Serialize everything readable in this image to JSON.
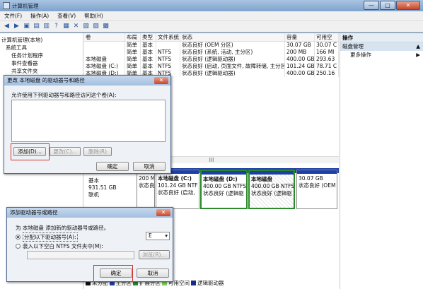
{
  "window": {
    "title": "计算机管理",
    "btn_min": "—",
    "btn_max": "□",
    "btn_close": "✕"
  },
  "menu": [
    "文件(F)",
    "操作(A)",
    "查看(V)",
    "帮助(H)"
  ],
  "tree": [
    "计算机管理(本地)",
    "系统工具",
    "任务计划程序",
    "事件查看器",
    "共享文件夹"
  ],
  "volumes": {
    "headers": [
      "卷",
      "布局",
      "类型",
      "文件系统",
      "状态",
      "容量",
      "可用空"
    ],
    "rows": [
      [
        "",
        "简单",
        "基本",
        "",
        "状态良好 (OEM 分区)",
        "30.07 GB",
        "30.07 C"
      ],
      [
        "",
        "简单",
        "基本",
        "NTFS",
        "状态良好 (系统, 活动, 主分区)",
        "200 MB",
        "166 MI"
      ],
      [
        "本地磁盘",
        "简单",
        "基本",
        "NTFS",
        "状态良好 (逻辑驱动器)",
        "400.00 GB",
        "293.63"
      ],
      [
        "本地磁盘 (C:)",
        "简单",
        "基本",
        "NTFS",
        "状态良好 (启动, 页面文件, 故障转储, 主分区)",
        "101.24 GB",
        "78.71 C"
      ],
      [
        "本地磁盘 (D:)",
        "简单",
        "基本",
        "NTFS",
        "状态良好 (逻辑驱动器)",
        "400.00 GB",
        "250.16"
      ]
    ]
  },
  "actions": {
    "header": "操作",
    "sub": "磁盘管理",
    "more": "更多操作"
  },
  "disk": {
    "type": "基本",
    "size": "931.51 GB",
    "status": "联机",
    "parts": [
      {
        "line1": "",
        "line2": "200 M",
        "line3": "状态良"
      },
      {
        "line1": "本地磁盘 (C:)",
        "line2": "101.24 GB NTF",
        "line3": "状态良好 (启动,"
      },
      {
        "line1": "本地磁盘 (D:)",
        "line2": "400.00 GB NTFS",
        "line3": "状态良好 (逻辑驱"
      },
      {
        "line1": "本地磁盘",
        "line2": "400.00 GB NTFS",
        "line3": "状态良好 (逻辑驱"
      },
      {
        "line1": "",
        "line2": "30.07 GB",
        "line3": "状态良好 (OEM"
      }
    ]
  },
  "legend": [
    "未分配",
    "主分区",
    "扩展分区",
    "可用空间",
    "逻辑驱动器"
  ],
  "scroll_marker": "III",
  "dialog1": {
    "title": "更改 本地磁盘 的驱动器号和路径",
    "prompt": "允许使用下列驱动器号和路径访问这个卷(A):",
    "add": "添加(D)...",
    "change": "更改(C)...",
    "remove": "删除(R)",
    "ok": "确定",
    "cancel": "取消"
  },
  "dialog2": {
    "title": "添加驱动器号或路径",
    "prompt": "为 本地磁盘 添加新的驱动器号或路径。",
    "opt1": "分配以下驱动器号(A):",
    "letter": "E",
    "opt2": "装入以下空白 NTFS 文件夹中(M):",
    "browse": "浏览(R)...",
    "ok": "确定",
    "cancel": "取消"
  },
  "colors": {
    "accent": "#1e3fa6",
    "highlight": "#d8302a",
    "selection_border": "#2b8a2b"
  }
}
